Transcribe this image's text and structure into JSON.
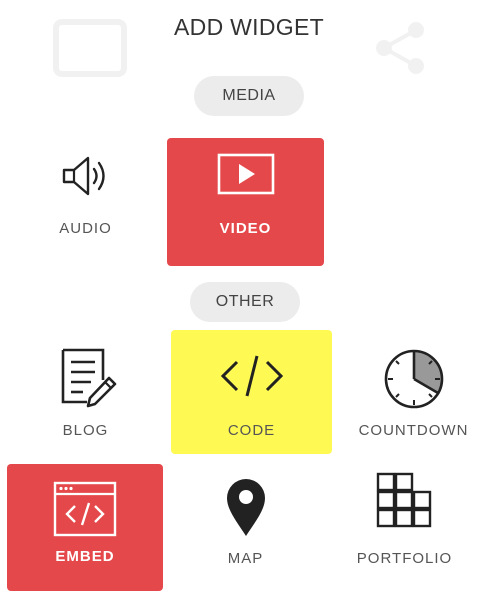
{
  "header": {
    "title": "ADD WIDGET"
  },
  "sections": {
    "media": {
      "label": "MEDIA"
    },
    "other": {
      "label": "OTHER"
    }
  },
  "widgets": {
    "audio": {
      "label": "AUDIO",
      "icon": "speaker-icon"
    },
    "video": {
      "label": "VIDEO",
      "icon": "video-play-icon",
      "state": "selected"
    },
    "blog": {
      "label": "BLOG",
      "icon": "document-pencil-icon"
    },
    "code": {
      "label": "CODE",
      "icon": "code-brackets-icon",
      "state": "highlighted"
    },
    "countdown": {
      "label": "COUNTDOWN",
      "icon": "clock-icon"
    },
    "embed": {
      "label": "EMBED",
      "icon": "embed-window-icon",
      "state": "selected"
    },
    "map": {
      "label": "MAP",
      "icon": "map-pin-icon"
    },
    "portfolio": {
      "label": "PORTFOLIO",
      "icon": "grid-icon"
    }
  },
  "colors": {
    "selected": "#e5484a",
    "highlight": "#fff954",
    "pill": "#ececec",
    "icon": "#222222"
  }
}
